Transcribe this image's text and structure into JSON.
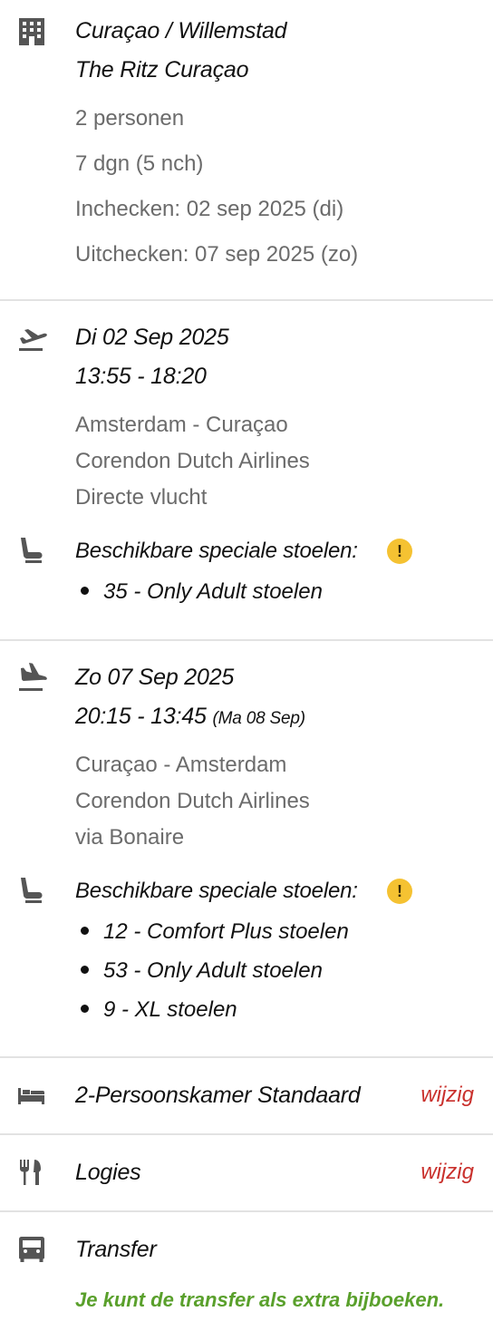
{
  "hotel": {
    "icon": "building-icon",
    "location": "Curaçao / Willemstad",
    "name": "The Ritz Curaçao",
    "persons": "2 personen",
    "duration": "7 dgn (5 nch)",
    "checkin": "Inchecken: 02 sep 2025 (di)",
    "checkout": "Uitchecken: 07 sep 2025 (zo)"
  },
  "outbound": {
    "icon": "plane-departure-icon",
    "date": "Di 02 Sep 2025",
    "time": "13:55 - 18:20",
    "route": "Amsterdam - Curaçao",
    "airline": "Corendon Dutch Airlines",
    "stops": "Directe vlucht",
    "seats_title": "Beschikbare speciale stoelen:",
    "seats": [
      "35 - Only Adult stoelen"
    ]
  },
  "return": {
    "icon": "plane-arrival-icon",
    "date": "Zo 07 Sep 2025",
    "time": "20:15 - 13:45",
    "arrival_note": "(Ma 08 Sep)",
    "route": "Curaçao - Amsterdam",
    "airline": "Corendon Dutch Airlines",
    "stops": "via Bonaire",
    "seats_title": "Beschikbare speciale stoelen:",
    "seats": [
      "12 - Comfort Plus stoelen",
      "53 - Only Adult stoelen",
      "9 - XL stoelen"
    ]
  },
  "room": {
    "icon": "bed-icon",
    "label": "2-Persoonskamer Standaard",
    "edit": "wijzig"
  },
  "board": {
    "icon": "fork-knife-icon",
    "label": "Logies",
    "edit": "wijzig"
  },
  "transfer": {
    "icon": "bus-icon",
    "label": "Transfer",
    "note": "Je kunt de transfer als extra bijboeken."
  },
  "warning_glyph": "!",
  "colors": {
    "accent_red": "#c9302c",
    "accent_green": "#5aa02c",
    "warning": "#f5c232",
    "muted_text": "#6b6b6b"
  }
}
